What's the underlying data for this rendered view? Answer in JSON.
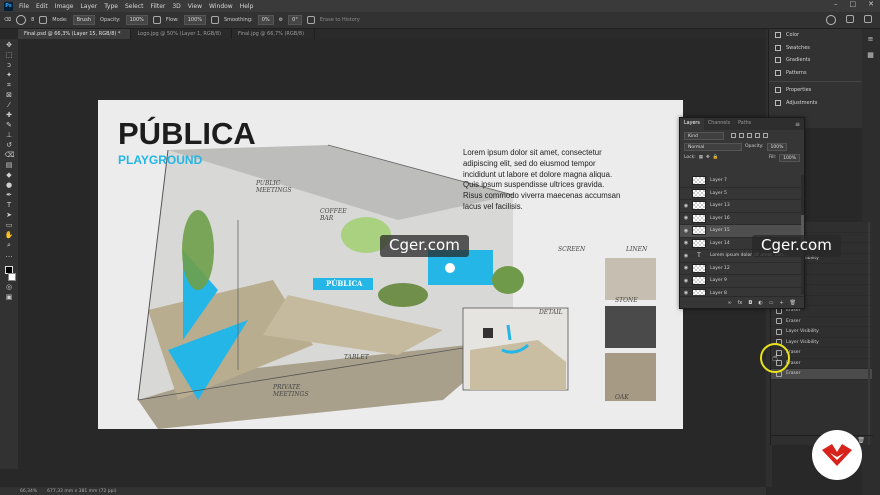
{
  "menu": {
    "app_icon": "Ps",
    "items": [
      "File",
      "Edit",
      "Image",
      "Layer",
      "Type",
      "Select",
      "Filter",
      "3D",
      "View",
      "Window",
      "Help"
    ]
  },
  "options": {
    "mode_label": "Mode:",
    "mode_value": "Brush",
    "opacity_label": "Opacity:",
    "opacity_value": "100%",
    "flow_label": "Flow:",
    "flow_value": "100%",
    "smoothing_label": "Smoothing:",
    "smoothing_value": "0%",
    "angle_value": "0°",
    "erase_history": "Erase to History"
  },
  "tabs": [
    {
      "label": "Final.psd @ 66,3% (Layer 15, RGB/8) *",
      "active": true
    },
    {
      "label": "Logo.jpg @ 50% (Layer 1, RGB/8)",
      "active": false
    },
    {
      "label": "Final.jpg @ 66,7% (RGB/8)",
      "active": false
    }
  ],
  "canvas": {
    "title": "PÚBLICA",
    "subtitle": "PLAYGROUND",
    "lorem": "Lorem ipsum dolor sit amet, consectetur adipiscing elit, sed do eiusmod tempor incididunt ut labore et dolore magna aliqua. Quis ipsum suspendisse ultrices gravida. Risus commodo viverra maecenas accumsan lacus vel facilisis.",
    "labels": {
      "public_meetings": "PUBLIC MEETINGS",
      "coffee_bar": "COFFEE BAR",
      "screen": "SCREEN",
      "linen": "LINEN",
      "stone": "STONE",
      "oak": "OAK",
      "detail": "DETAIL",
      "tablet": "TABLET",
      "private_meetings": "PRIVATE MEETINGS",
      "sign": "PÚBLICA"
    }
  },
  "status": {
    "zoom": "66,34%",
    "doc_size": "677,33 mm x 381 mm (72 ppi)"
  },
  "dock": {
    "group1": [
      "Color",
      "Swatches",
      "Gradients",
      "Patterns"
    ],
    "group2": [
      "Properties",
      "Adjustments"
    ]
  },
  "layers_panel": {
    "tabs": [
      "Layers",
      "Channels",
      "Paths"
    ],
    "kind_label": "Kind",
    "blend_mode": "Normal",
    "opacity_label": "Opacity:",
    "opacity_value": "100%",
    "lock_label": "Lock:",
    "fill_label": "Fill:",
    "fill_value": "100%",
    "layers": [
      {
        "name": "Layer 7",
        "visible": false,
        "type": "pixel",
        "selected": false
      },
      {
        "name": "Layer 5",
        "visible": false,
        "type": "pixel",
        "selected": false
      },
      {
        "name": "Layer 13",
        "visible": true,
        "type": "pixel",
        "selected": false
      },
      {
        "name": "Layer 16",
        "visible": true,
        "type": "pixel",
        "selected": false
      },
      {
        "name": "Layer 15",
        "visible": true,
        "type": "pixel",
        "selected": true
      },
      {
        "name": "Layer 14",
        "visible": true,
        "type": "pixel",
        "selected": false
      },
      {
        "name": "Lorem ipsum dolor sit amet, con...",
        "visible": true,
        "type": "text",
        "selected": false
      },
      {
        "name": "Layer 12",
        "visible": true,
        "type": "pixel",
        "selected": false
      },
      {
        "name": "Layer 9",
        "visible": true,
        "type": "pixel",
        "selected": false
      },
      {
        "name": "Layer 8",
        "visible": true,
        "type": "pixel",
        "selected": false
      }
    ]
  },
  "history": {
    "items": [
      "Eraser",
      "Eraser",
      "Layer Visibility",
      "Layer Visibility",
      "Eraser",
      "Eraser",
      "Eraser",
      "Eraser",
      "Eraser",
      "Eraser",
      "Layer Visibility",
      "Layer Visibility",
      "Eraser",
      "Eraser",
      "Eraser"
    ],
    "selected_index": 14
  },
  "watermark": "Cger.com",
  "colors": {
    "accent_cyan": "#23b6e6",
    "cursor_ring": "#e8e31a",
    "badge_red": "#d8231c"
  }
}
